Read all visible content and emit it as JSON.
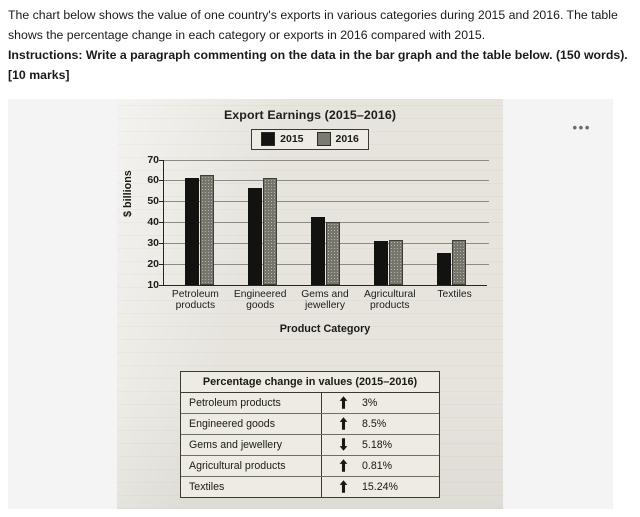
{
  "prompt": {
    "line1": "The chart below shows the value of one country's exports in various categories during 2015 and 2016. The table shows the percentage change in each category or exports in 2016 compared with 2015.",
    "line2": "Instructions: Write a paragraph commenting on the data in the bar graph and the table below. (150 words).",
    "line3": "[10 marks]"
  },
  "panel": {
    "menu_label": "•••"
  },
  "chart_data": {
    "type": "bar",
    "title": "Export Earnings (2015–2016)",
    "xlabel": "Product Category",
    "ylabel": "$ billions",
    "ylim": [
      10,
      70
    ],
    "yticks": [
      10,
      20,
      30,
      40,
      50,
      60,
      70
    ],
    "grid": true,
    "legend_position": "top-center",
    "categories": [
      "Petroleum products",
      "Engineered goods",
      "Gems and jewellery",
      "Agricultural products",
      "Textiles"
    ],
    "categories_display": [
      [
        "Petroleum",
        "products"
      ],
      [
        "Engineered",
        "goods"
      ],
      [
        "Gems and",
        "jewellery"
      ],
      [
        "Agricultural",
        "products"
      ],
      [
        "Textiles",
        ""
      ]
    ],
    "series": [
      {
        "name": "2015",
        "color": "#121210",
        "values": [
          61.0,
          56.3,
          42.5,
          31.0,
          25.4
        ]
      },
      {
        "name": "2016",
        "color": "#76756c",
        "values": [
          62.8,
          61.0,
          40.3,
          31.5,
          31.5
        ]
      }
    ]
  },
  "pct_table": {
    "title": "Percentage change in values (2015–2016)",
    "rows": [
      {
        "category": "Petroleum products",
        "direction": "up",
        "value": "3%"
      },
      {
        "category": "Engineered goods",
        "direction": "up",
        "value": "8.5%"
      },
      {
        "category": "Gems and jewellery",
        "direction": "down",
        "value": "5.18%"
      },
      {
        "category": "Agricultural products",
        "direction": "up",
        "value": "0.81%"
      },
      {
        "category": "Textiles",
        "direction": "up",
        "value": "15.24%"
      }
    ]
  }
}
